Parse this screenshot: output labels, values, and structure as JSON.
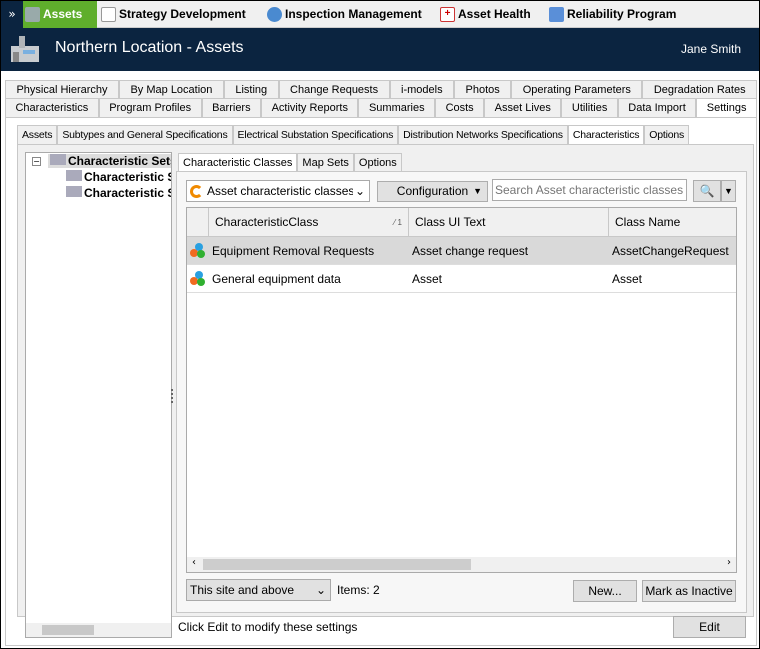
{
  "topbar": {
    "apps": [
      {
        "label": "Assets",
        "icon": "gears-icon"
      },
      {
        "label": "Strategy Development",
        "icon": "document-icon"
      },
      {
        "label": "Inspection Management",
        "icon": "gauge-icon"
      },
      {
        "label": "Asset Health",
        "icon": "first-aid-icon"
      },
      {
        "label": "Reliability Program",
        "icon": "calendar-icon"
      }
    ],
    "active_color": "#5fae2c"
  },
  "header": {
    "title": "Northern Location - Assets",
    "user": "Jane Smith",
    "bg": "#0b2440"
  },
  "tabs_row1": [
    "Physical Hierarchy",
    "By Map Location",
    "Listing",
    "Change Requests",
    "i-models",
    "Photos",
    "Operating Parameters",
    "Degradation Rates"
  ],
  "tabs_row2": [
    "Characteristics",
    "Program Profiles",
    "Barriers",
    "Activity Reports",
    "Summaries",
    "Costs",
    "Asset Lives",
    "Utilities",
    "Data Import",
    "Settings"
  ],
  "subtabs": [
    "Assets",
    "Subtypes and General Specifications",
    "Electrical Substation Specifications",
    "Distribution Networks Specifications",
    "Characteristics",
    "Options"
  ],
  "tree": {
    "root": "Characteristic Sets",
    "children": [
      "Characteristic Sets",
      "Characteristic Sets"
    ]
  },
  "inner_tabs": [
    "Characteristic Classes",
    "Map Sets",
    "Options"
  ],
  "toolbar": {
    "scope_select": "Asset characteristic classes at this site",
    "configuration": "Configuration",
    "search_placeholder": "Search Asset characteristic classes at your site"
  },
  "grid": {
    "columns": [
      "CharacteristicClass",
      "Class UI Text",
      "Class Name"
    ],
    "sort_indicator": "1",
    "rows": [
      [
        "Equipment Removal Requests",
        "Asset change request",
        "AssetChangeRequest"
      ],
      [
        "General equipment data",
        "Asset",
        "Asset"
      ]
    ]
  },
  "footer": {
    "site_filter": "This site and above",
    "items": "Items: 2",
    "new": "New...",
    "inactive": "Mark as Inactive",
    "status": "Click Edit to modify these settings",
    "edit": "Edit"
  }
}
